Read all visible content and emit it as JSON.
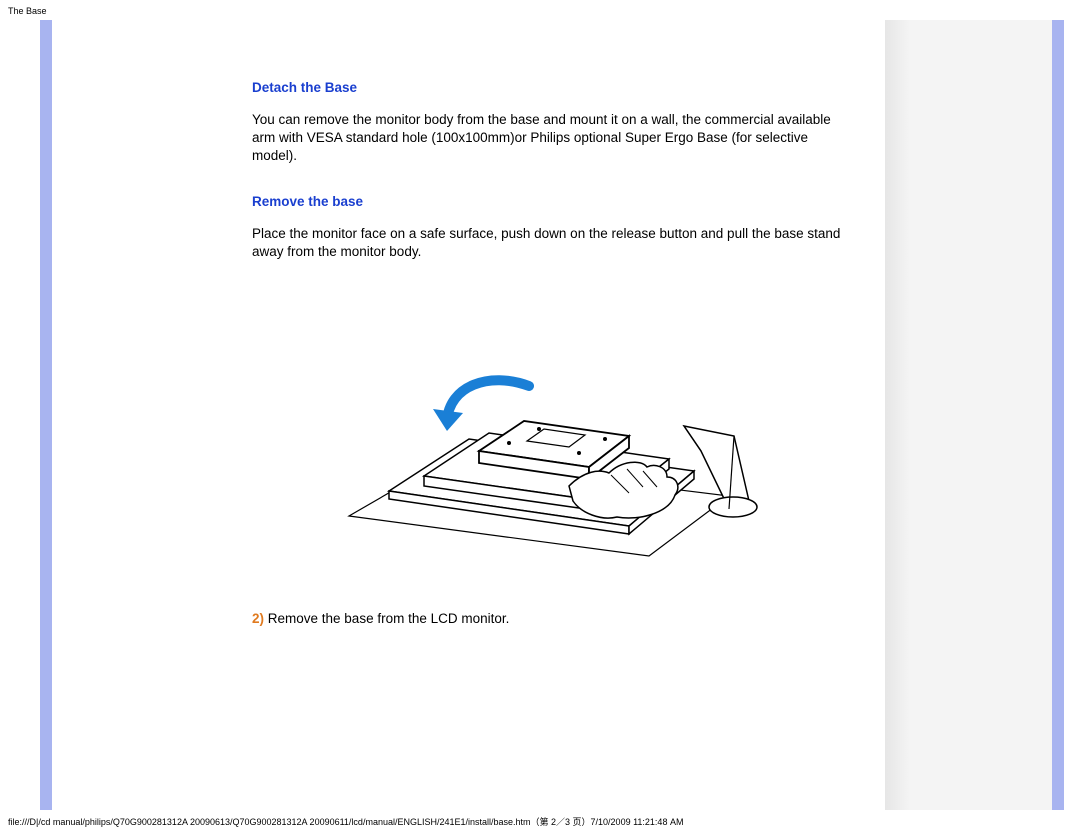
{
  "header": {
    "title": "The Base"
  },
  "content": {
    "heading1": "Detach the Base",
    "para1": "You can remove the monitor body from the base and mount it on a wall, the commercial available arm with VESA standard hole (100x100mm)or Philips optional Super Ergo Base (for selective model).",
    "heading2": "Remove the base",
    "para2": "Place the monitor face on a safe surface, push down on the release button and pull the base stand away from the monitor body.",
    "step_num": "2)",
    "step_text": " Remove  the base from the LCD monitor."
  },
  "footer": {
    "path": "file:///D|/cd manual/philips/Q70G900281312A 20090613/Q70G900281312A 20090611/lcd/manual/ENGLISH/241E1/install/base.htm（第 2／3 页）7/10/2009 11:21:48 AM"
  }
}
